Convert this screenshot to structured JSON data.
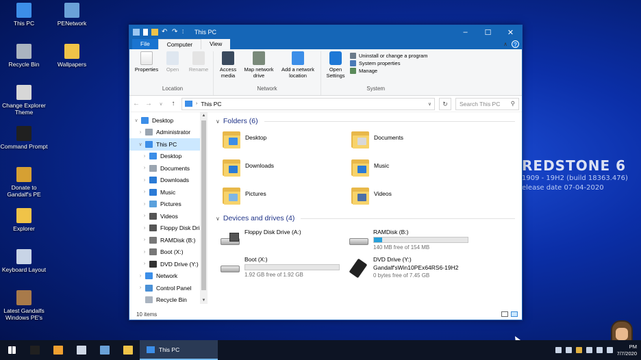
{
  "desktop": {
    "icons": [
      {
        "label": "This PC",
        "icon": "this-pc-icon",
        "color": "#3c8ee8"
      },
      {
        "label": "PENetwork",
        "icon": "network-icon",
        "color": "#6aa1d8"
      },
      {
        "label": "Recycle Bin",
        "icon": "recycle-bin-icon",
        "color": "#aab4c0"
      },
      {
        "label": "Wallpapers",
        "icon": "wallpapers-icon",
        "color": "#f0c348"
      },
      {
        "label": "Change Explorer Theme",
        "icon": "theme-icon",
        "color": "#d7d7d7"
      },
      {
        "label": "Command Prompt",
        "icon": "cmd-icon",
        "color": "#202020"
      },
      {
        "label": "Donate to Gandalf's PE",
        "icon": "donate-icon",
        "color": "#d6a033"
      },
      {
        "label": "Explorer",
        "icon": "folder-icon",
        "color": "#f0c348"
      },
      {
        "label": "Keyboard Layout",
        "icon": "keyboard-icon",
        "color": "#c8d4e6"
      },
      {
        "label": "Latest Gandalfs Windows PE's",
        "icon": "gandalf-icon",
        "color": "#a87a4a"
      }
    ],
    "wallpaper": {
      "title": "REDSTONE 6",
      "line1": "1909 - 19H2 (build 18363.476)",
      "line2": "elease date  07-04-2020"
    }
  },
  "window": {
    "title": "This PC",
    "tabs": {
      "file": "File",
      "computer": "Computer",
      "view": "View"
    },
    "ribbon": {
      "location": {
        "label": "Location",
        "properties": "Properties",
        "open": "Open",
        "rename": "Rename"
      },
      "network": {
        "label": "Network",
        "access_media": "Access media",
        "map_drive": "Map network drive",
        "add_location": "Add a network location"
      },
      "system": {
        "label": "System",
        "open_settings": "Open Settings",
        "uninstall": "Uninstall or change a program",
        "system_properties": "System properties",
        "manage": "Manage"
      }
    },
    "address": {
      "path": "This PC",
      "search_placeholder": "Search This PC"
    },
    "nav": [
      {
        "label": "Desktop",
        "level": 0,
        "chev": "v",
        "color": "#3c8ee8",
        "icon": "desktop-icon"
      },
      {
        "label": "Administrator",
        "level": 1,
        "chev": ">",
        "color": "#9aa5b1",
        "icon": "user-icon"
      },
      {
        "label": "This PC",
        "level": 1,
        "chev": "v",
        "color": "#3c8ee8",
        "icon": "this-pc-icon",
        "selected": true
      },
      {
        "label": "Desktop",
        "level": 2,
        "chev": ">",
        "color": "#3c8ee8",
        "icon": "desktop-icon"
      },
      {
        "label": "Documents",
        "level": 2,
        "chev": ">",
        "color": "#9aa5b1",
        "icon": "documents-icon"
      },
      {
        "label": "Downloads",
        "level": 2,
        "chev": ">",
        "color": "#2b7bd6",
        "icon": "downloads-icon"
      },
      {
        "label": "Music",
        "level": 2,
        "chev": ">",
        "color": "#2b7bd6",
        "icon": "music-icon"
      },
      {
        "label": "Pictures",
        "level": 2,
        "chev": ">",
        "color": "#5aa0dc",
        "icon": "pictures-icon"
      },
      {
        "label": "Videos",
        "level": 2,
        "chev": ">",
        "color": "#555555",
        "icon": "videos-icon"
      },
      {
        "label": "Floppy Disk Dri",
        "level": 2,
        "chev": ">",
        "color": "#555555",
        "icon": "floppy-icon"
      },
      {
        "label": "RAMDisk (B:)",
        "level": 2,
        "chev": ">",
        "color": "#777777",
        "icon": "drive-icon"
      },
      {
        "label": "Boot (X:)",
        "level": 2,
        "chev": ">",
        "color": "#777777",
        "icon": "drive-icon"
      },
      {
        "label": "DVD Drive (Y:)",
        "level": 2,
        "chev": ">",
        "color": "#333333",
        "icon": "dvd-icon"
      },
      {
        "label": "Network",
        "level": 1,
        "chev": ">",
        "color": "#3c8ee8",
        "icon": "network-icon"
      },
      {
        "label": "Control Panel",
        "level": 1,
        "chev": ">",
        "color": "#4a90d6",
        "icon": "control-panel-icon"
      },
      {
        "label": "Recycle Bin",
        "level": 1,
        "chev": "",
        "color": "#aab4c0",
        "icon": "recycle-bin-icon"
      }
    ],
    "folders_header": "Folders (6)",
    "folders": [
      {
        "label": "Desktop",
        "badge": "#3c8ee8",
        "icon": "desktop-folder-icon"
      },
      {
        "label": "Documents",
        "badge": "#d8d8d8",
        "icon": "documents-folder-icon"
      },
      {
        "label": "Downloads",
        "badge": "#2b7bd6",
        "icon": "downloads-folder-icon"
      },
      {
        "label": "Music",
        "badge": "#2b7bd6",
        "icon": "music-folder-icon"
      },
      {
        "label": "Pictures",
        "badge": "#7fb6e6",
        "icon": "pictures-folder-icon"
      },
      {
        "label": "Videos",
        "badge": "#4b6fa8",
        "icon": "videos-folder-icon"
      }
    ],
    "drives_header": "Devices and drives (4)",
    "drives": [
      {
        "label": "Floppy Disk Drive (A:)",
        "kind": "floppy",
        "icon": "floppy-drive-icon",
        "free": "",
        "used_fraction": null
      },
      {
        "label": "RAMDisk (B:)",
        "kind": "hdd",
        "icon": "hard-drive-icon",
        "free": "140 MB free of 154 MB",
        "used_fraction": 0.09
      },
      {
        "label": "Boot (X:)",
        "kind": "hdd",
        "icon": "hard-drive-icon",
        "free": "1.92 GB free of 1.92 GB",
        "used_fraction": 0.0
      },
      {
        "label": "DVD Drive (Y:)",
        "sublabel": "Gandalf'sWin10PEx64RS6-19H2",
        "kind": "usb",
        "icon": "dvd-drive-icon",
        "free": "0 bytes free of 7.45 GB",
        "used_fraction": null
      }
    ],
    "status": "10 items"
  },
  "taskbar": {
    "icons": [
      {
        "name": "start-button",
        "color": "#ffffff"
      },
      {
        "name": "cmd-taskbar-icon",
        "color": "#202020"
      },
      {
        "name": "media-taskbar-icon",
        "color": "#f0a030"
      },
      {
        "name": "notepad-taskbar-icon",
        "color": "#cfd8e6"
      },
      {
        "name": "network-taskbar-icon",
        "color": "#6aa1d8"
      },
      {
        "name": "explorer-taskbar-icon",
        "color": "#f0c348"
      }
    ],
    "active_app": "This PC",
    "time": "PM",
    "date": "7/7/2020"
  }
}
